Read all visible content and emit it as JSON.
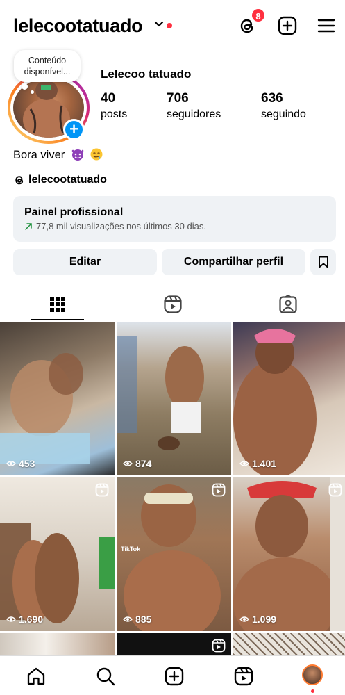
{
  "header": {
    "username": "lelecootatuado",
    "threads_badge": "8"
  },
  "profile": {
    "note": "Conteúdo disponível...",
    "full_name": "Lelecoo tatuado",
    "stats": [
      {
        "value": "40",
        "label": "posts"
      },
      {
        "value": "706",
        "label": "seguidores"
      },
      {
        "value": "636",
        "label": "seguindo"
      }
    ],
    "bio": "Bora viver",
    "threads_handle": "lelecootatuado"
  },
  "professional_panel": {
    "title": "Painel profissional",
    "subtitle": "77,8 mil visualizações nos últimos 30 dias."
  },
  "buttons": {
    "edit": "Editar",
    "share": "Compartilhar perfil"
  },
  "grid": {
    "posts": [
      {
        "views": "453",
        "reel": false
      },
      {
        "views": "874",
        "reel": false
      },
      {
        "views": "1.401",
        "reel": false
      },
      {
        "views": "1.690",
        "reel": true
      },
      {
        "views": "885",
        "reel": true
      },
      {
        "views": "1.099",
        "reel": true
      }
    ],
    "watermark": "TikTok"
  },
  "colors": {
    "accent_blue": "#0095f6",
    "notification_red": "#ff3040",
    "panel_bg": "#eff2f5"
  }
}
